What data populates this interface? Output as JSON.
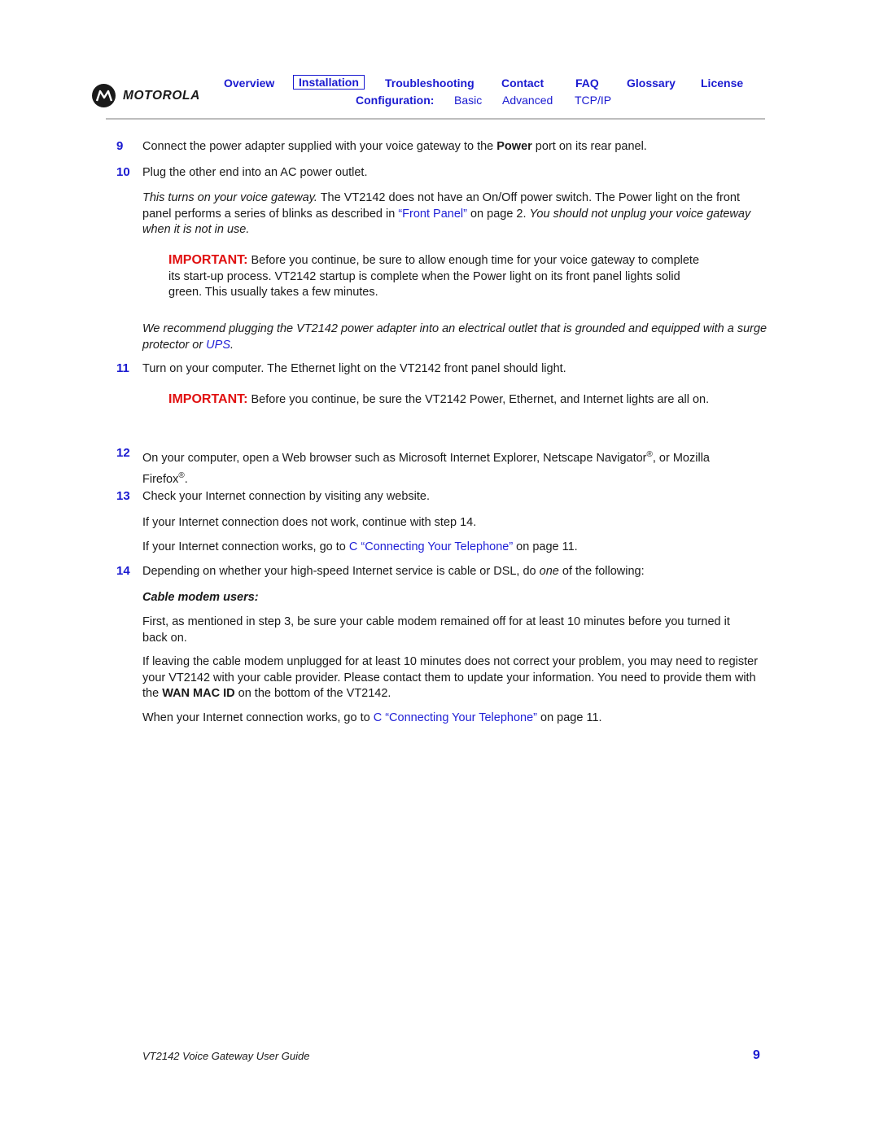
{
  "header": {
    "logo_text": "MOTOROLA",
    "nav": [
      {
        "label": "Overview",
        "selected": false
      },
      {
        "label": "Installation",
        "selected": true
      },
      {
        "label": "Troubleshooting",
        "selected": false
      },
      {
        "label": "Contact",
        "selected": false
      },
      {
        "label": "FAQ",
        "selected": false
      },
      {
        "label": "Glossary",
        "selected": false
      },
      {
        "label": "License",
        "selected": false
      }
    ],
    "config_label": "Configuration:",
    "config_links": [
      "Basic",
      "Advanced",
      "TCP/IP"
    ]
  },
  "steps": {
    "s9": {
      "num": "9",
      "pre": "Connect the power adapter supplied with your voice gateway to the ",
      "bold": "Power",
      "post": " port on its rear panel."
    },
    "s10": {
      "num": "10",
      "text": "Plug the other end into an AC power outlet."
    },
    "p10": {
      "italic1": "This turns on your voice gateway.",
      "text1": " The VT2142 does not have an On/Off power switch. The Power light on the front panel performs a series of blinks as described in ",
      "link": "“Front Panel”",
      "text2": " on page 2. ",
      "italic2": "You should not unplug your voice gateway when it is not in use."
    },
    "imp1": {
      "label": "IMPORTANT:",
      "text": " Before you continue, be sure to allow enough time for your voice gateway to complete its start-up process. VT2142 startup is complete when the Power light on its front panel lights solid green. This usually takes a few minutes."
    },
    "rec": {
      "text": "We recommend plugging the VT2142 power adapter into an electrical outlet that is grounded and equipped with a surge protector or ",
      "link": "UPS",
      "end": "."
    },
    "s11": {
      "num": "11",
      "text": "Turn on your computer. The Ethernet light on the VT2142 front panel should light."
    },
    "imp2": {
      "label": "IMPORTANT:",
      "text": " Before you continue, be sure the VT2142 Power, Ethernet, and Internet lights are all on."
    },
    "s12": {
      "num": "12",
      "text1": "On your computer, open a Web browser such as Microsoft Internet Explorer, Netscape Navigator",
      "reg": "®",
      "text2": ", or Mozilla Firefox",
      "end": "."
    },
    "s13": {
      "num": "13",
      "text": "Check your Internet connection by visiting any website."
    },
    "p13a": "If your Internet connection does not work, continue with step 14.",
    "p13b": {
      "pre": "If your Internet connection works, go to ",
      "link": "C “Connecting Your Telephone”",
      "post": " on page 11."
    },
    "s14": {
      "num": "14",
      "pre": "Depending on whether your high-speed Internet service is cable or DSL, do ",
      "italic": "one",
      "post": " of the following:"
    },
    "cable_heading": "Cable modem users:",
    "cable1": "First, as mentioned in step 3, be sure your cable modem remained off for at least 10 minutes before you turned it back on.",
    "cable2": {
      "pre": "If leaving the cable modem unplugged for at least 10 minutes does not correct your problem, you may need to register your VT2142 with your cable provider. Please contact them to update your information. You need to provide them with the ",
      "bold": "WAN MAC ID",
      "post": " on the bottom of the VT2142."
    },
    "cable3": {
      "pre": "When your Internet connection works, go to ",
      "link": "C “Connecting Your Telephone”",
      "post": " on page 11."
    }
  },
  "footer": {
    "title": "VT2142 Voice Gateway User Guide",
    "page": "9"
  }
}
